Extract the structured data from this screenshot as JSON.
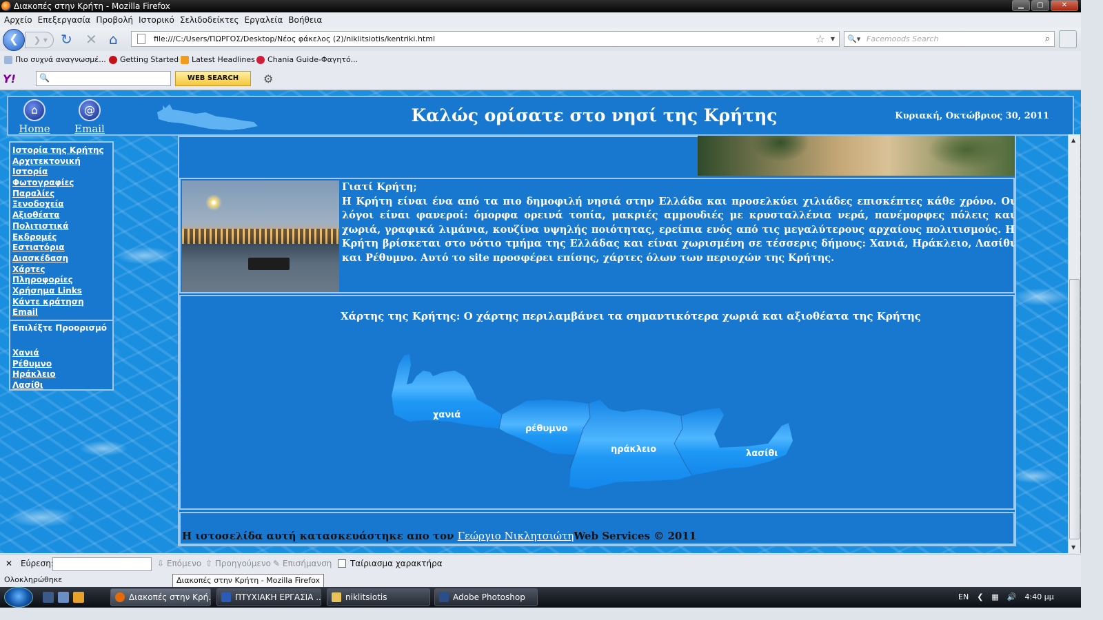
{
  "window": {
    "title": "Διακοπές στην Κρήτη - Mozilla Firefox"
  },
  "menu": [
    "Αρχείο",
    "Επεξεργασία",
    "Προβολή",
    "Ιστορικό",
    "Σελιδοδείκτες",
    "Εργαλεία",
    "Βοήθεια"
  ],
  "nav": {
    "url": "file:///C:/Users/ΠΩΡΓΟΣ/Desktop/Νέος φάκελος (2)/niklitsiotis/kentriki.html",
    "search_placeholder": "Facemoods Search"
  },
  "bookmarks": [
    "Πιο συχνά αναγνωσμέ...",
    "Getting Started",
    "Latest Headlines",
    "Chania Guide-Φαγητό..."
  ],
  "yahoo": {
    "logo": "Y!",
    "button": "WEB SEARCH"
  },
  "page": {
    "home_label": "Home",
    "email_label": "Email",
    "welcome": "Καλώς ορίσατε στο νησί της Κρήτης",
    "date": "Κυριακή, Οκτώβριος 30, 2011",
    "menu_items": [
      "Ιστορία της Κρήτης",
      "Αρχιτεκτονική",
      "Ιστορία",
      "Φωτογραφίες",
      "Παραλίες",
      "Ξενοδοχεία",
      "Αξιοθέατα",
      "Πολιτιστικά",
      "Εκδρομές",
      "Εστιατόρια",
      "Διασκέδαση",
      "Χάρτες",
      "Πληροφορίες",
      "Χρήσημα Links",
      "Κάντε κράτηση",
      "Email"
    ],
    "destination_title": "Επιλέξτε Προορισμό",
    "destinations": [
      "Χανιά",
      "Ρέθυμνο",
      "Ηράκλειο",
      "Λασίθι"
    ],
    "why_title": "Γιατί Κρήτη;",
    "why_text": "Η Κρήτη είναι ένα από τα πιο δημοφιλή νησιά στην Ελλάδα και προσελκύει χιλιάδες επισκέπτες κάθε χρόνο. Οι λόγοι είναι φανεροί: όμορφα ορεινά τοπία, μακριές αμμουδιές με κρυσταλλένια νερά, πανέμορφες πόλεις και χωριά, γραφικά λιμάνια, κουζίνα υψηλής ποιότητας, ερείπια ενός από τις μεγαλύτερους αρχαίους πολιτισμούς. Η Κρήτη βρίσκεται στο νότιο τμήμα της Ελλάδας και είναι χωρισμένη σε τέσσερις δήμους: Χανιά, Ηράκλειο, Λασίθι και Ρέθυμνο. Αυτό το site προσφέρει επίσης, χάρτες όλων των περιοχών της Κρήτης.",
    "map_caption": "Χάρτης της Κρήτης: Ο χάρτης περιλαμβάνει τα σημαντικότερα χωριά και αξιοθέατα της Κρήτης",
    "map_labels": [
      "χανιά",
      "ρέθυμνο",
      "ηράκλειο",
      "λασίθι"
    ],
    "footer_pre": "Η ιστοσελίδα αυτή κατασκευάστηκε απο τον ",
    "footer_link": "Γεώργιο Νικλητσιώτη",
    "footer_post": "Web Services © 2011"
  },
  "find": {
    "label": "Εύρεση:",
    "next": "Επόμενο",
    "prev": "Προηγούμενο",
    "highlight": "Επισήμανση",
    "match_case": "Ταίριασμα χαρακτήρα"
  },
  "status": {
    "text": "Ολοκληρώθηκε",
    "tooltip": "Διακοπές στην Κρήτη - Mozilla Firefox"
  },
  "taskbar": {
    "tasks": [
      "Διακοπές στην Κρή...",
      "ΠΤΥΧΙΑΚΗ ΕΡΓΑΣΙΑ ...",
      "niklitsiotis",
      "Adobe Photoshop"
    ],
    "lang": "EN",
    "time": "4:40 μμ"
  },
  "colors": {
    "page_blue": "#1878d0",
    "water": "#1a8fe0",
    "map": "#1e90f0"
  }
}
